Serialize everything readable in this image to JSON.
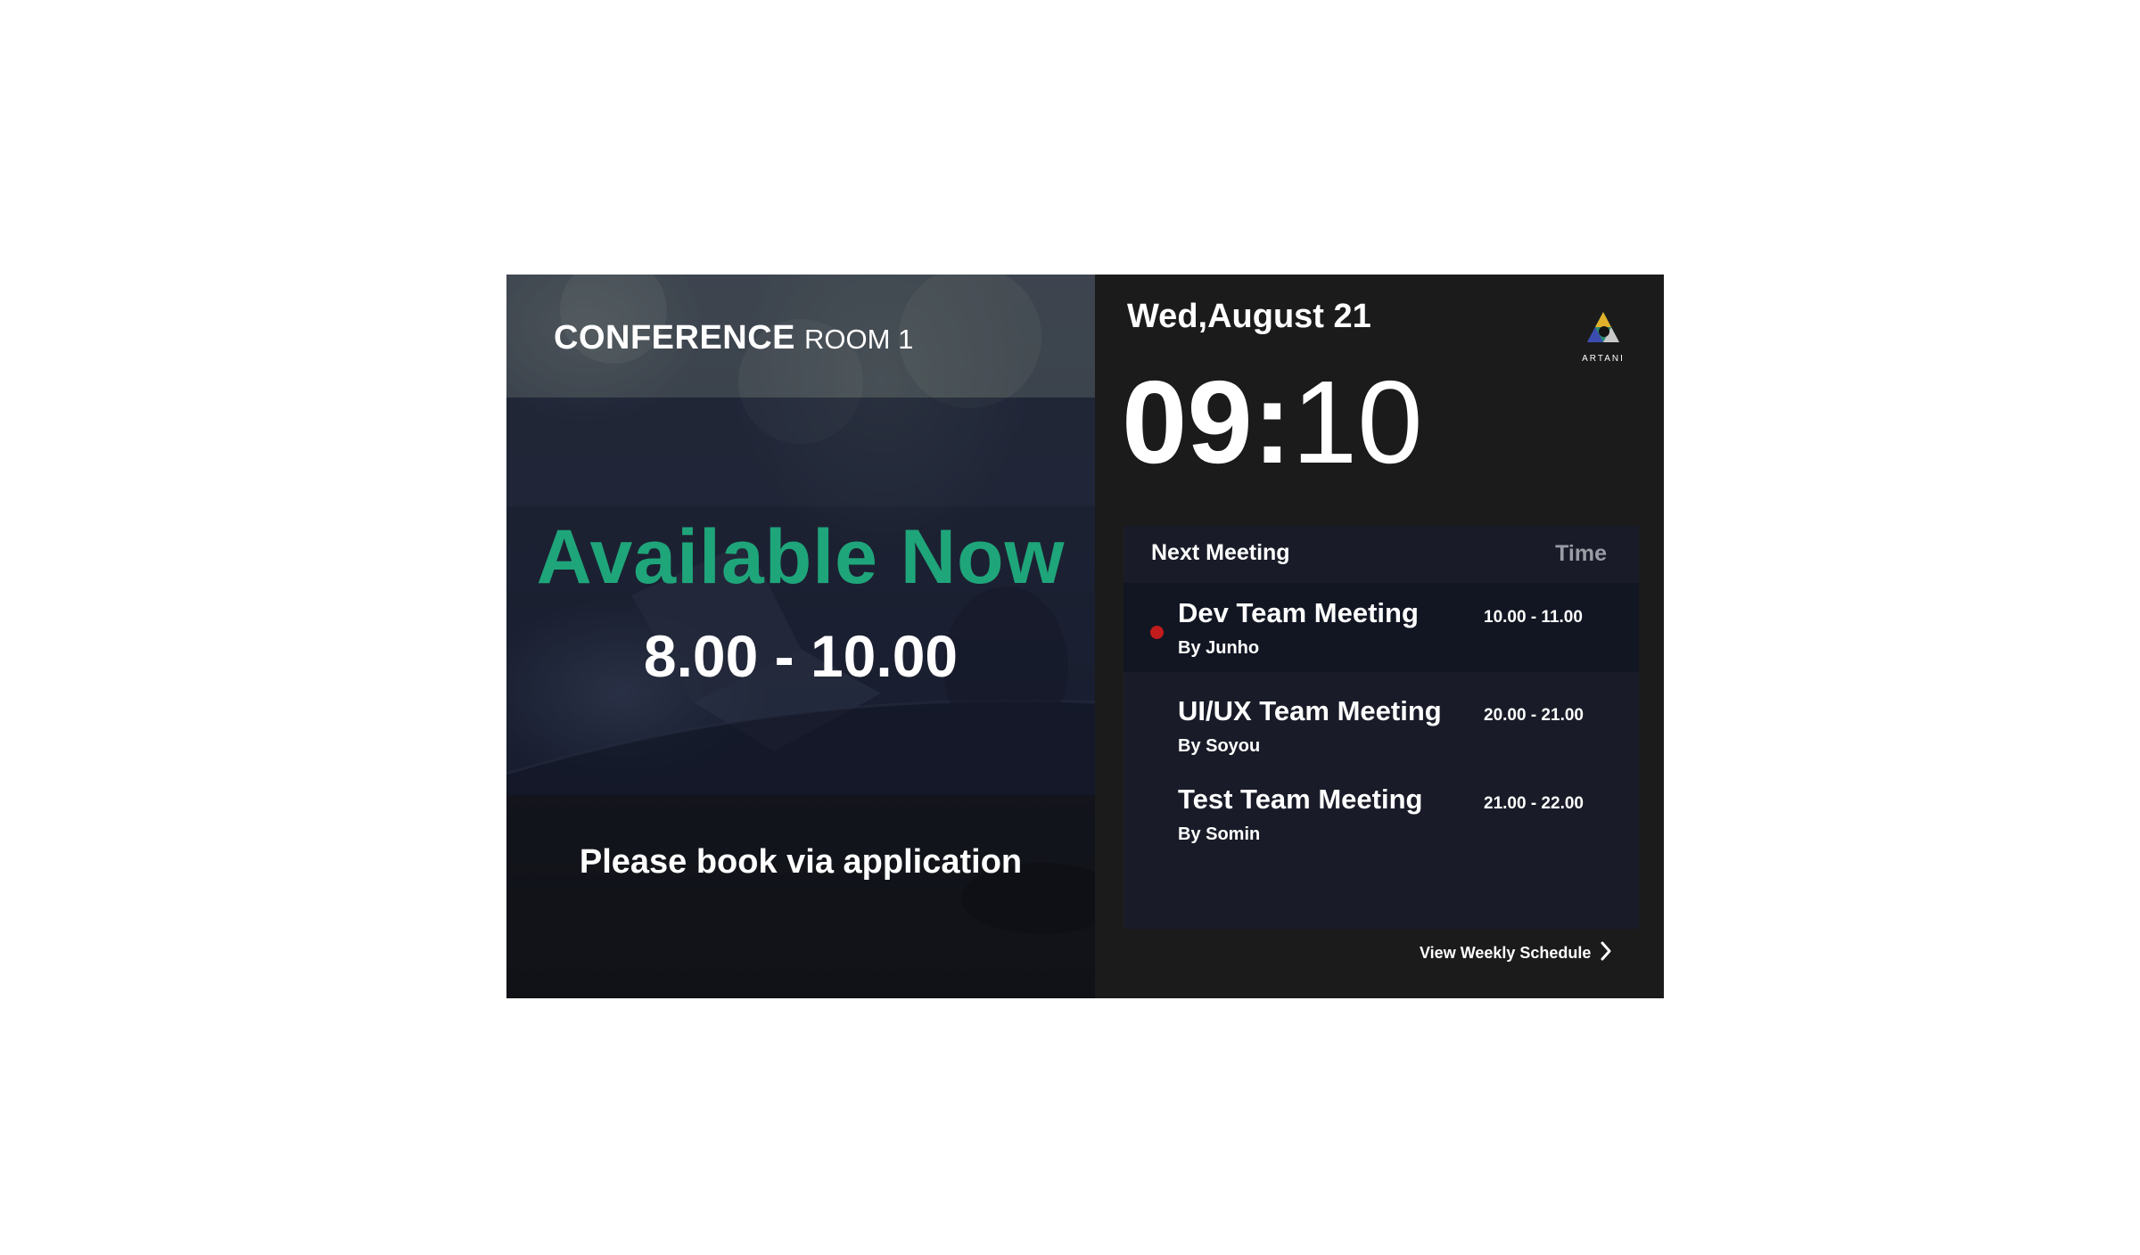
{
  "room": {
    "name_strong": "CONFERENCE",
    "name_light": "ROOM 1"
  },
  "availability": {
    "status": "Available Now",
    "slot": "8.00 - 10.00",
    "cta": "Please book via application",
    "status_color": "#1fa57a"
  },
  "header": {
    "date": "Wed,August 21",
    "logo_text": "ARTANI"
  },
  "clock": {
    "hours": "09",
    "separator": ":",
    "minutes": "10"
  },
  "meetings": {
    "title": "Next Meeting",
    "time_header": "Time",
    "items": [
      {
        "title": "Dev Team Meeting",
        "by": "By Junho",
        "time": "10.00 - 11.00",
        "current": true
      },
      {
        "title": "UI/UX Team Meeting",
        "by": "By Soyou",
        "time": "20.00 - 21.00",
        "current": false
      },
      {
        "title": "Test Team Meeting",
        "by": "By Somin",
        "time": "21.00 - 22.00",
        "current": false
      }
    ],
    "current_indicator_color": "#c21b1b"
  },
  "footer": {
    "weekly_link": "View Weekly Schedule",
    "weekly_icon": "chevron-right-icon"
  }
}
